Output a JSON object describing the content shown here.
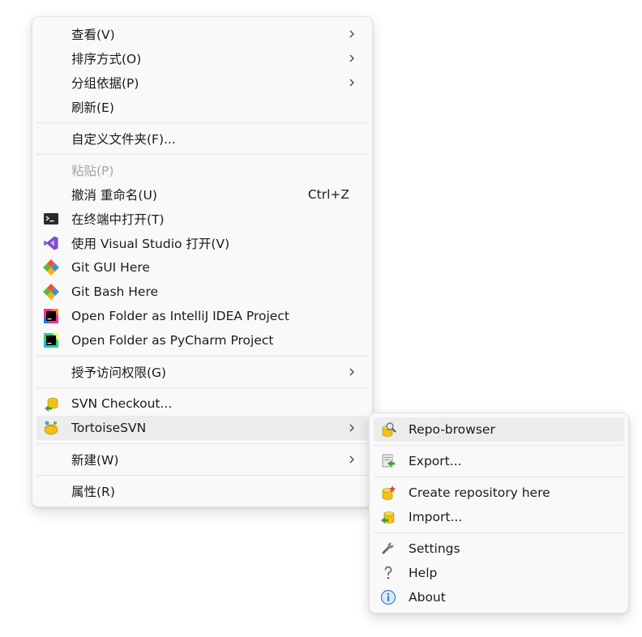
{
  "context_menu": {
    "items": {
      "view": {
        "label": "查看(V)"
      },
      "sort": {
        "label": "排序方式(O)"
      },
      "group": {
        "label": "分组依据(P)"
      },
      "refresh": {
        "label": "刷新(E)"
      },
      "customize": {
        "label": "自定义文件夹(F)..."
      },
      "paste": {
        "label": "粘贴(P)",
        "disabled": true
      },
      "undo": {
        "label": "撤消 重命名(U)",
        "shortcut": "Ctrl+Z"
      },
      "terminal": {
        "label": "在终端中打开(T)",
        "icon": "terminal-icon"
      },
      "vs": {
        "label": "使用 Visual Studio 打开(V)",
        "icon": "visual-studio-icon"
      },
      "git_gui": {
        "label": "Git GUI Here",
        "icon": "git-icon"
      },
      "git_bash": {
        "label": "Git Bash Here",
        "icon": "git-icon"
      },
      "intellij": {
        "label": "Open Folder as IntelliJ IDEA Project",
        "icon": "intellij-idea-icon"
      },
      "pycharm": {
        "label": "Open Folder as PyCharm Project",
        "icon": "pycharm-icon"
      },
      "access": {
        "label": "授予访问权限(G)"
      },
      "svn_checkout": {
        "label": "SVN Checkout...",
        "icon": "svn-checkout-icon"
      },
      "tortoise": {
        "label": "TortoiseSVN",
        "icon": "tortoisesvn-icon",
        "highlighted": true
      },
      "new": {
        "label": "新建(W)"
      },
      "properties": {
        "label": "属性(R)"
      }
    }
  },
  "tortoise_submenu": {
    "items": {
      "repo_browser": {
        "label": "Repo-browser",
        "icon": "repo-browser-icon",
        "highlighted": true
      },
      "export": {
        "label": "Export...",
        "icon": "export-icon"
      },
      "create_repo": {
        "label": "Create repository here",
        "icon": "create-repository-icon"
      },
      "import": {
        "label": "Import...",
        "icon": "import-icon"
      },
      "settings": {
        "label": "Settings",
        "icon": "wrench-icon"
      },
      "help": {
        "label": "Help",
        "icon": "help-icon"
      },
      "about": {
        "label": "About",
        "icon": "info-icon"
      }
    }
  },
  "colors": {
    "menu_bg": "#f9f9f9",
    "hover_bg": "#ececec",
    "separator": "#e2e2e2",
    "disabled_text": "#a6a6a6",
    "svn_yellow": "#f2c21b",
    "svn_green": "#3aa335"
  }
}
